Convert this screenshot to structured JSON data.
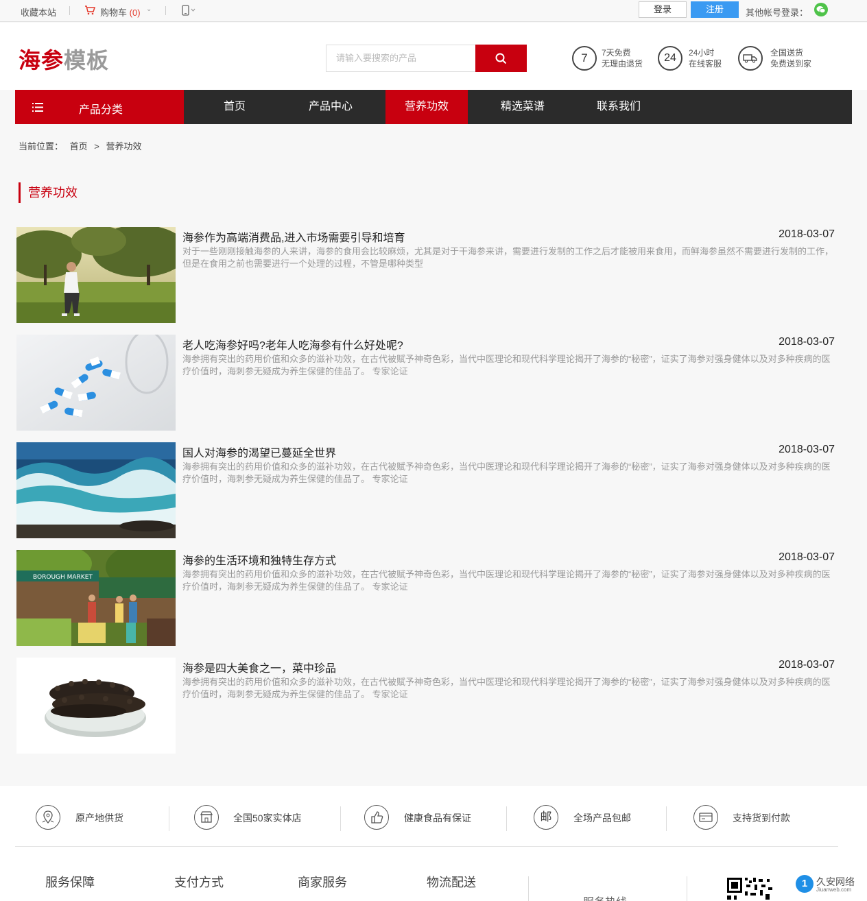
{
  "topbar": {
    "bookmark": "收藏本站",
    "cart_label": "购物车",
    "cart_count": "(0)",
    "login": "登录",
    "register": "注册",
    "other_login": "其他帐号登录："
  },
  "header": {
    "logo_part1": "海参",
    "logo_part2": "模板",
    "search_placeholder": "请输入要搜索的产品",
    "services": [
      {
        "icon_text": "7",
        "line1": "7天免费",
        "line2": "无理由退货"
      },
      {
        "icon_text": "24",
        "line1": "24小时",
        "line2": "在线客服"
      },
      {
        "icon_text": "",
        "line1": "全国送货",
        "line2": "免费送到家"
      }
    ]
  },
  "nav": {
    "category": "产品分类",
    "items": [
      "首页",
      "产品中心",
      "营养功效",
      "精选菜谱",
      "联系我们"
    ],
    "active_index": 2
  },
  "breadcrumb": {
    "prefix": "当前位置：",
    "home": "首页",
    "sep": ">",
    "current": "营养功效"
  },
  "section_title": "营养功效",
  "articles": [
    {
      "title": "海参作为高端消费品,进入市场需要引导和培育",
      "date": "2018-03-07",
      "desc": "对于一些刚刚接触海参的人来讲，海参的食用会比较麻烦，尤其是对于干海参来讲，需要进行发制的工作之后才能被用来食用，而鲜海参虽然不需要进行发制的工作，但是在食用之前也需要进行一个处理的过程，不管是哪种类型",
      "image": "running-woman-park"
    },
    {
      "title": "老人吃海参好吗?老年人吃海参有什么好处呢?",
      "date": "2018-03-07",
      "desc": "海参拥有突出的药用价值和众多的滋补功效，在古代被赋予神奇色彩，当代中医理论和现代科学理论揭开了海参的“秘密”，证实了海参对强身健体以及对多种疾病的医疗价值时，海刺参无疑成为养生保健的佳品了。 专家论证",
      "image": "capsules-glass"
    },
    {
      "title": "国人对海参的渴望已蔓延全世界",
      "date": "2018-03-07",
      "desc": "海参拥有突出的药用价值和众多的滋补功效，在古代被赋予神奇色彩，当代中医理论和现代科学理论揭开了海参的“秘密”，证实了海参对强身健体以及对多种疾病的医疗价值时，海刺参无疑成为养生保健的佳品了。 专家论证",
      "image": "ocean-waves"
    },
    {
      "title": "海参的生活环境和独特生存方式",
      "date": "2018-03-07",
      "desc": "海参拥有突出的药用价值和众多的滋补功效，在古代被赋予神奇色彩，当代中医理论和现代科学理论揭开了海参的“秘密”，证实了海参对强身健体以及对多种疾病的医疗价值时，海刺参无疑成为养生保健的佳品了。 专家论证",
      "image": "borough-market",
      "sign_text": "BOROUGH MARKET"
    },
    {
      "title": "海参是四大美食之一，菜中珍品",
      "date": "2018-03-07",
      "desc": "海参拥有突出的药用价值和众多的滋补功效，在古代被赋予神奇色彩，当代中医理论和现代科学理论揭开了海参的“秘密”，证实了海参对强身健体以及对多种疾病的医疗价值时，海刺参无疑成为养生保健的佳品了。 专家论证",
      "image": "sea-cucumber-plate"
    }
  ],
  "footer": {
    "features": [
      {
        "label": "原产地供货",
        "icon": "location-pin-icon"
      },
      {
        "label": "全国50家实体店",
        "icon": "store-icon"
      },
      {
        "label": "健康食品有保证",
        "icon": "thumbs-up-icon"
      },
      {
        "label": "全场产品包邮",
        "icon": "mail-icon",
        "glyph": "邮"
      },
      {
        "label": "支持货到付款",
        "icon": "card-icon"
      }
    ],
    "columns": [
      "服务保障",
      "支付方式",
      "商家服务",
      "物流配送"
    ],
    "hotline": "服务热线",
    "watermark_text": "久安网络",
    "watermark_sub": "Jiuanweb.com"
  },
  "colors": {
    "brand_red": "#c8000f",
    "nav_dark": "#2b2b2b",
    "register_blue": "#3a9af2"
  }
}
